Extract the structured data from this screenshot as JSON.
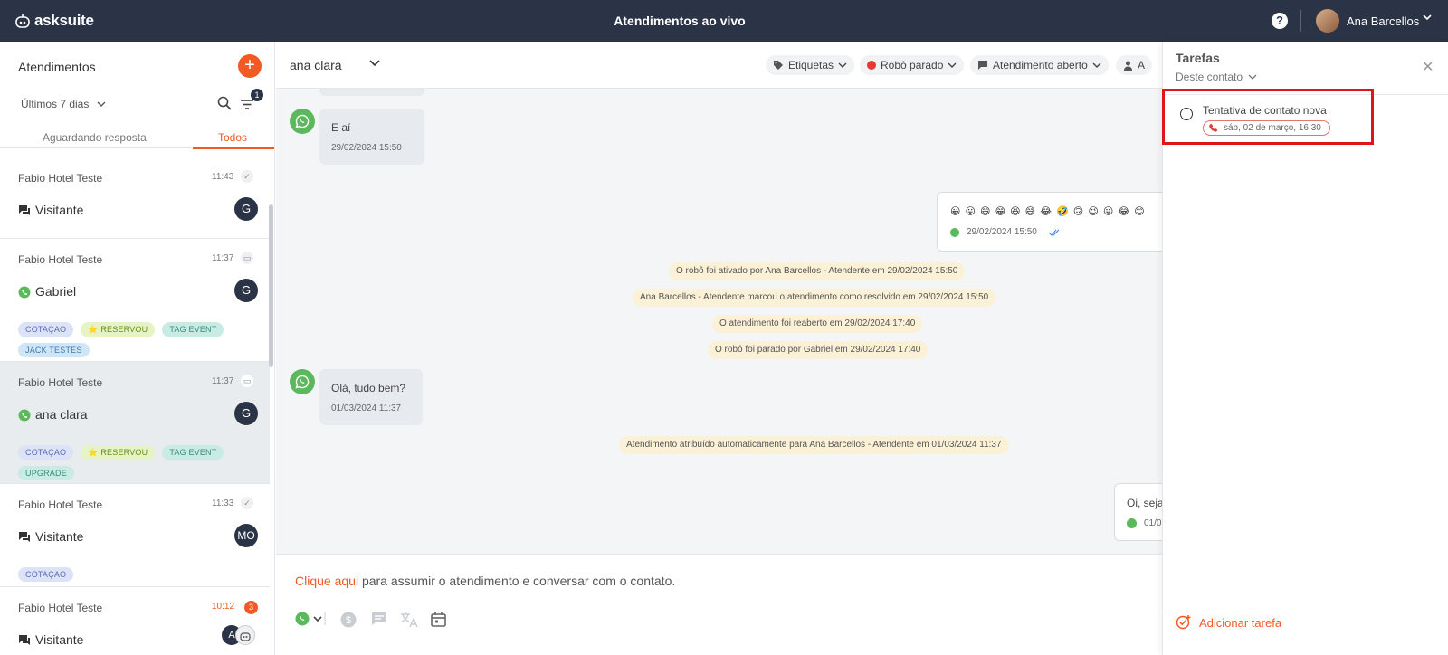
{
  "brand": {
    "name": "asksuite"
  },
  "topbar": {
    "title": "Atendimentos ao vivo",
    "help": "?",
    "user_name": "Ana Barcellos",
    "chevron": "⌄"
  },
  "left": {
    "title": "Atendimentos",
    "add": "+",
    "period": "Últimos 7 dias",
    "filter_count": "1",
    "tabs": [
      "Aguardando resposta",
      "Todos"
    ],
    "conversations": [
      {
        "hotel": "Fabio Hotel Teste",
        "time": "11:43",
        "status": "✓",
        "name": "Visitante",
        "avatar": "G",
        "tags": []
      },
      {
        "hotel": "Fabio Hotel Teste",
        "time": "11:37",
        "status": "▭",
        "name": "Gabriel",
        "avatar": "G",
        "tags": [
          "COTAÇAO",
          "⭐ RESERVOU",
          "TAG EVENT",
          "JACK TESTES"
        ]
      },
      {
        "hotel": "Fabio Hotel Teste",
        "time": "11:37",
        "status": "▭",
        "name": "ana clara",
        "avatar": "G",
        "tags": [
          "COTAÇAO",
          "⭐ RESERVOU",
          "TAG EVENT",
          "UPGRADE"
        ]
      },
      {
        "hotel": "Fabio Hotel Teste",
        "time": "11:33",
        "status": "✓",
        "name": "Visitante",
        "avatar": "MO",
        "tags": [
          "COTAÇAO"
        ]
      },
      {
        "hotel": "Fabio Hotel Teste",
        "time": "10:12",
        "count": "3",
        "name": "Visitante",
        "avatar": "A"
      }
    ]
  },
  "chat": {
    "contact": "ana clara",
    "pills": {
      "tags": "Etiquetas",
      "robot": "Robô parado",
      "status": "Atendimento aberto",
      "agent": "A"
    },
    "messages": [
      {
        "text": "E aí",
        "time": "29/02/2024 15:50"
      },
      {
        "emojis": "😀 😛 😄 😁 😆 😅 😂 🤣 🙃 😉 😜 😂 😊",
        "time": "29/02/2024 15:50"
      },
      {
        "text": "Olá, tudo bem?",
        "time": "01/03/2024 11:37"
      },
      {
        "text": "Oi, seja",
        "time": "01/0"
      }
    ],
    "system": [
      "O robô foi ativado por Ana Barcellos - Atendente em 29/02/2024 15:50",
      "Ana Barcellos - Atendente marcou o atendimento como resolvido em 29/02/2024 15:50",
      "O atendimento foi reaberto em 29/02/2024 17:40",
      "O robô foi parado por Gabriel em 29/02/2024 17:40",
      "Atendimento atribuído automaticamente para Ana Barcellos - Atendente em 01/03/2024 11:37"
    ],
    "composer": {
      "link": "Clique aqui",
      "rest": " para assumir o atendimento e conversar com o contato."
    }
  },
  "tasks": {
    "title": "Tarefas",
    "filter": "Deste contato",
    "close": "✕",
    "items": [
      {
        "name": "Tentativa de contato nova",
        "due": "sáb, 02 de março, 16:30"
      }
    ],
    "add": "Adicionar tarefa"
  },
  "colors": {
    "accent": "#f15a24",
    "topbar": "#2b3346",
    "whatsapp": "#5cb85c"
  }
}
